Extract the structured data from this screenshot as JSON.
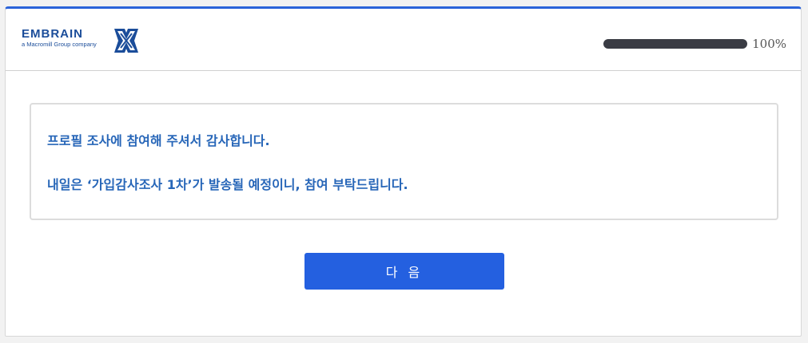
{
  "header": {
    "logo": {
      "brand": "EMBRAIN",
      "tagline": "a Macromill Group company",
      "mark_icon": "embrain-x-mark-icon"
    },
    "progress": {
      "value_percent": 100,
      "label": "100%"
    }
  },
  "main": {
    "messages": [
      "프로필 조사에 참여해 주셔서 감사합니다.",
      "내일은 ‘가입감사조사 1차’가 발송될 예정이니, 참여 부탁드립니다."
    ]
  },
  "actions": {
    "next_label": "다 음"
  },
  "colors": {
    "accent": "#2460e0",
    "top_border": "#2b63d9",
    "message_text": "#2766b8",
    "progress_bar": "#3a3c44",
    "logo": "#1b4d9a"
  }
}
